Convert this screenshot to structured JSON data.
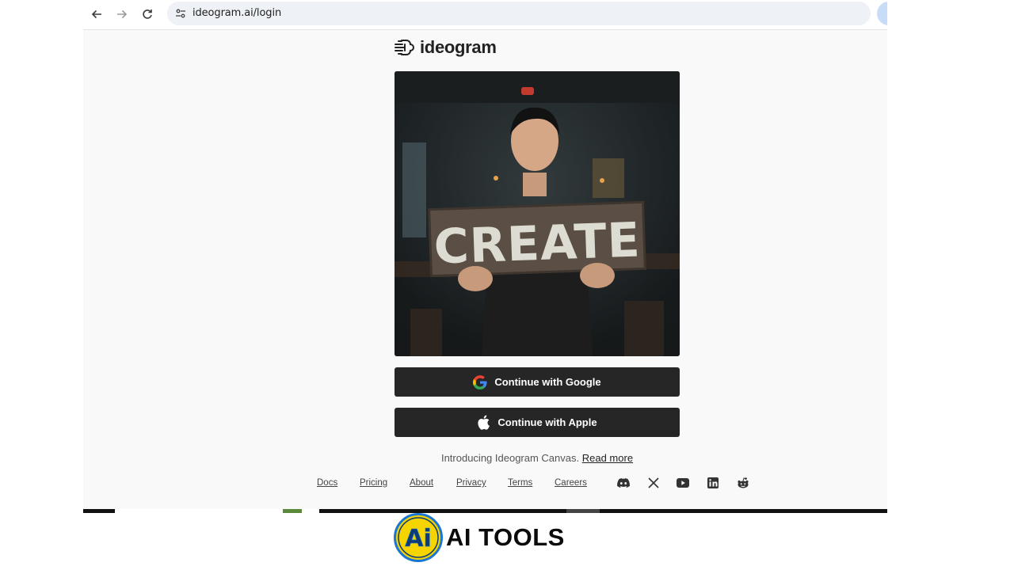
{
  "browser": {
    "url": "ideogram.ai/login",
    "icons": [
      "back-icon",
      "forward-icon",
      "reload-icon",
      "site-settings-icon",
      "bookmark-star-icon"
    ]
  },
  "page": {
    "logo_text": "ideogram",
    "hero_sign_text": "CREATE",
    "google_button": "Continue with Google",
    "apple_button": "Continue with Apple",
    "intro_text": "Introducing Ideogram Canvas.",
    "intro_link": "Read more",
    "footer_links": [
      "Docs",
      "Pricing",
      "About",
      "Privacy",
      "Terms",
      "Careers"
    ],
    "social_icons": [
      "discord-icon",
      "x-icon",
      "youtube-icon",
      "linkedin-icon",
      "reddit-icon"
    ]
  },
  "watermark": {
    "badge_text": "Ai",
    "label": "AI TOOLS"
  },
  "colors": {
    "button_bg": "#262626",
    "page_bg": "#f9f9f9",
    "badge_yellow": "#f5d400",
    "badge_blue": "#1976d2"
  }
}
